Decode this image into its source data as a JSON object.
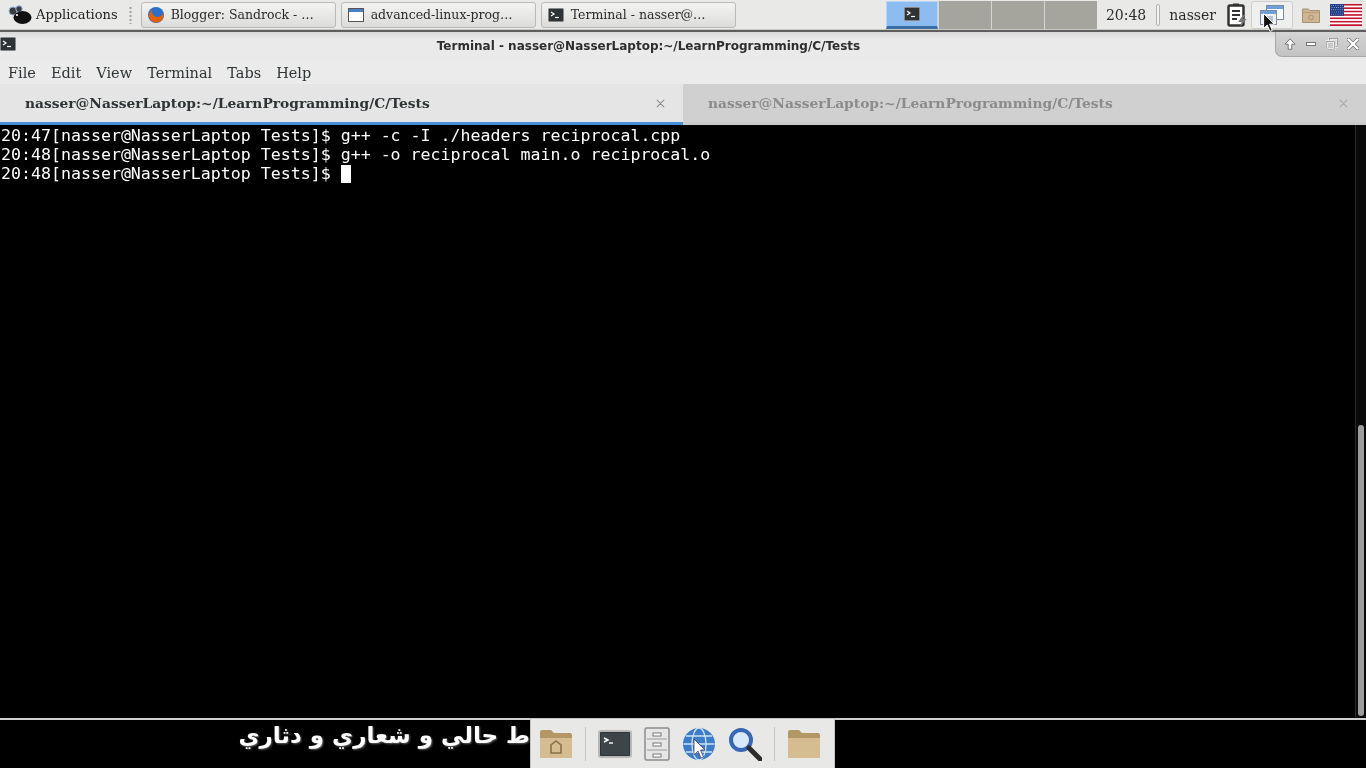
{
  "top_panel": {
    "app_menu": "Applications",
    "tasks": [
      {
        "kind": "browser",
        "label": "Blogger: Sandrock - …"
      },
      {
        "kind": "window",
        "label": "advanced-linux-prog…"
      },
      {
        "kind": "terminal",
        "label": "Terminal - nasser@…"
      }
    ],
    "workspaces": [
      {
        "selected": true
      },
      {
        "selected": false
      },
      {
        "selected": false
      },
      {
        "selected": false
      }
    ],
    "clock": "20:48",
    "user": "nasser"
  },
  "window": {
    "title": "Terminal - nasser@NasserLaptop:~/LearnProgramming/C/Tests",
    "menu": [
      "File",
      "Edit",
      "View",
      "Terminal",
      "Tabs",
      "Help"
    ],
    "tabs": [
      {
        "label": "nasser@NasserLaptop:~/LearnProgramming/C/Tests",
        "selected": true
      },
      {
        "label": "nasser@NasserLaptop:~/LearnProgramming/C/Tests",
        "selected": false
      }
    ],
    "terminal": {
      "lines": [
        "20:47[nasser@NasserLaptop Tests]$ g++ -c -I ./headers reciprocal.cpp",
        "20:48[nasser@NasserLaptop Tests]$ g++ -o reciprocal main.o reciprocal.o",
        "20:48[nasser@NasserLaptop Tests]$"
      ],
      "cursor": true
    }
  },
  "desktop": {
    "wallpaper_text": "ط حالي و شعاري و دثاري"
  }
}
